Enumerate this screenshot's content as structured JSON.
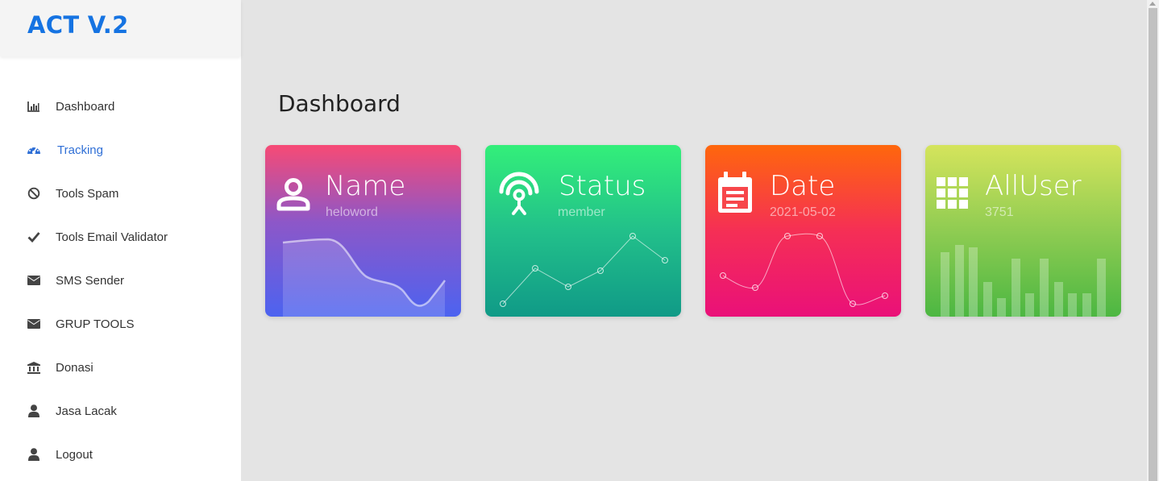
{
  "app": {
    "title": "ACT V.2",
    "accent": "#1573e2"
  },
  "sidebar": {
    "items": [
      {
        "label": "Dashboard",
        "icon": "bar-chart-icon",
        "active": false
      },
      {
        "label": "Tracking",
        "icon": "tachometer-icon",
        "active": true
      },
      {
        "label": "Tools Spam",
        "icon": "ban-icon",
        "active": false
      },
      {
        "label": "Tools Email Validator",
        "icon": "check-icon",
        "active": false
      },
      {
        "label": "SMS Sender",
        "icon": "envelope-icon",
        "active": false
      },
      {
        "label": "GRUP TOOLS",
        "icon": "envelope-icon",
        "active": false
      },
      {
        "label": "Donasi",
        "icon": "bank-icon",
        "active": false
      },
      {
        "label": "Jasa Lacak",
        "icon": "user-icon",
        "active": false
      },
      {
        "label": "Logout",
        "icon": "user-icon",
        "active": false
      }
    ]
  },
  "main": {
    "title": "Dashboard"
  },
  "cards": [
    {
      "title": "Name",
      "subtitle": "heloword",
      "icon": "user-outline-icon",
      "chart": "area"
    },
    {
      "title": "Status",
      "subtitle": "member",
      "icon": "antenna-signal-icon",
      "chart": "line"
    },
    {
      "title": "Date",
      "subtitle": "2021-05-02",
      "icon": "calendar-icon",
      "chart": "curve"
    },
    {
      "title": "AllUser",
      "subtitle": "3751",
      "icon": "grid-apps-icon",
      "chart": "bar"
    }
  ]
}
